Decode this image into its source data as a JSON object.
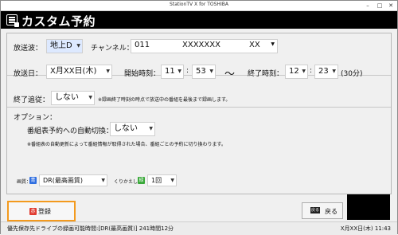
{
  "window": {
    "title": "StationTV X for TOSHIBA"
  },
  "header": {
    "title": "カスタム予約"
  },
  "form": {
    "broadcast_wave_label": "放送波：",
    "broadcast_wave_value": "地上D",
    "channel_label": "チャンネル：",
    "channel_number": "011",
    "channel_name": "XXXXXXX",
    "channel_sub": "XX",
    "date_label": "放送日：",
    "date_value": "X月XX日(木)",
    "start_label": "開始時刻：",
    "start_hour": "11",
    "start_min": "53",
    "tilde": "〜",
    "end_label": "終了時刻：",
    "end_hour": "12",
    "end_min": "23",
    "duration": "(30分)",
    "follow_label": "終了追従：",
    "follow_value": "しない",
    "follow_note": "※録画終了時刻の時点で放送中の番組を最後まで録画します。",
    "options_label": "オプション：",
    "auto_switch_label": "番組表予約への自動切換：",
    "auto_switch_value": "しない",
    "auto_switch_note": "※番組表の自動更新によって番組情報が取得された場合、番組ごとの予約に切り換わります。"
  },
  "bottom": {
    "quality_label": "画質：",
    "quality_chip": "青",
    "quality_value": "DR(最高画質)",
    "repeat_label": "くりかえし：",
    "repeat_chip": "緑",
    "repeat_value": "1回"
  },
  "buttons": {
    "register_chip": "赤",
    "register_label": "登録",
    "back_chip": "戻る",
    "back_label": "戻る"
  },
  "status": {
    "left": "優先保存先ドライブの録画可能時間:[DR(最高画質)] 241時間12分",
    "right": "X月XX日(木) 11:43"
  },
  "colors": {
    "accent_orange": "#f39a1e",
    "chip_red": "#e03a2f",
    "chip_blue": "#2f6ee0",
    "chip_green": "#38a838"
  }
}
